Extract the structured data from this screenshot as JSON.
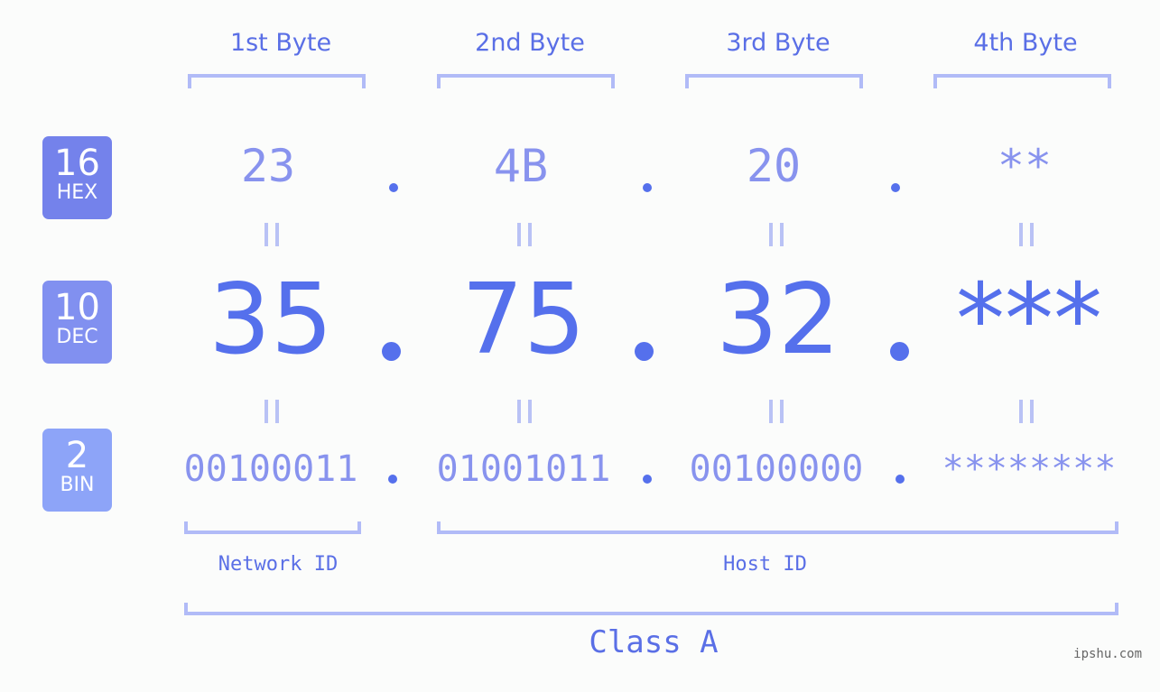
{
  "byte_headers": [
    "1st Byte",
    "2nd Byte",
    "3rd Byte",
    "4th Byte"
  ],
  "badges": [
    {
      "number": "16",
      "label": "HEX",
      "color": "#7482eb"
    },
    {
      "number": "10",
      "label": "DEC",
      "color": "#8190f0"
    },
    {
      "number": "2",
      "label": "BIN",
      "color": "#8da4f8"
    }
  ],
  "hex": [
    "23",
    "4B",
    "20",
    "**"
  ],
  "dec": [
    "35",
    "75",
    "32",
    "***"
  ],
  "bin": [
    "00100011",
    "01001011",
    "00100000",
    "********"
  ],
  "separator": ".",
  "labels": {
    "network_id": "Network ID",
    "host_id": "Host ID",
    "class": "Class A"
  },
  "watermark": "ipshu.com",
  "colors": {
    "primary": "#5570ec",
    "light_value": "#8893ee",
    "bracket": "#b1bbf7",
    "background": "#fbfcfb"
  }
}
